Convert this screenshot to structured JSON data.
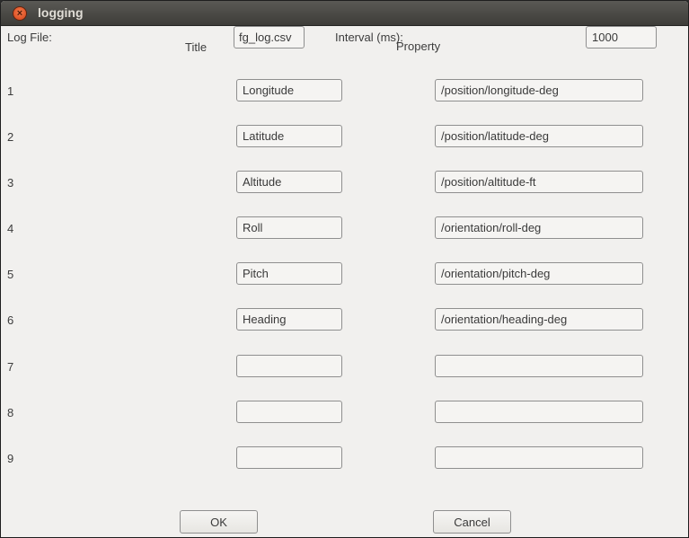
{
  "window": {
    "title": "logging",
    "close_glyph": "×"
  },
  "header": {
    "log_file_label": "Log File:",
    "log_file_value": "fg_log.csv",
    "interval_label": "Interval (ms):",
    "interval_value": "1000",
    "title_column": "Title",
    "property_column": "Property"
  },
  "rows": [
    {
      "num": "1",
      "title": "Longitude",
      "property": "/position/longitude-deg"
    },
    {
      "num": "2",
      "title": "Latitude",
      "property": "/position/latitude-deg"
    },
    {
      "num": "3",
      "title": "Altitude",
      "property": "/position/altitude-ft"
    },
    {
      "num": "4",
      "title": "Roll",
      "property": "/orientation/roll-deg"
    },
    {
      "num": "5",
      "title": "Pitch",
      "property": "/orientation/pitch-deg"
    },
    {
      "num": "6",
      "title": "Heading",
      "property": "/orientation/heading-deg"
    },
    {
      "num": "7",
      "title": "",
      "property": ""
    },
    {
      "num": "8",
      "title": "",
      "property": ""
    },
    {
      "num": "9",
      "title": "",
      "property": ""
    }
  ],
  "buttons": {
    "ok": "OK",
    "cancel": "Cancel"
  }
}
